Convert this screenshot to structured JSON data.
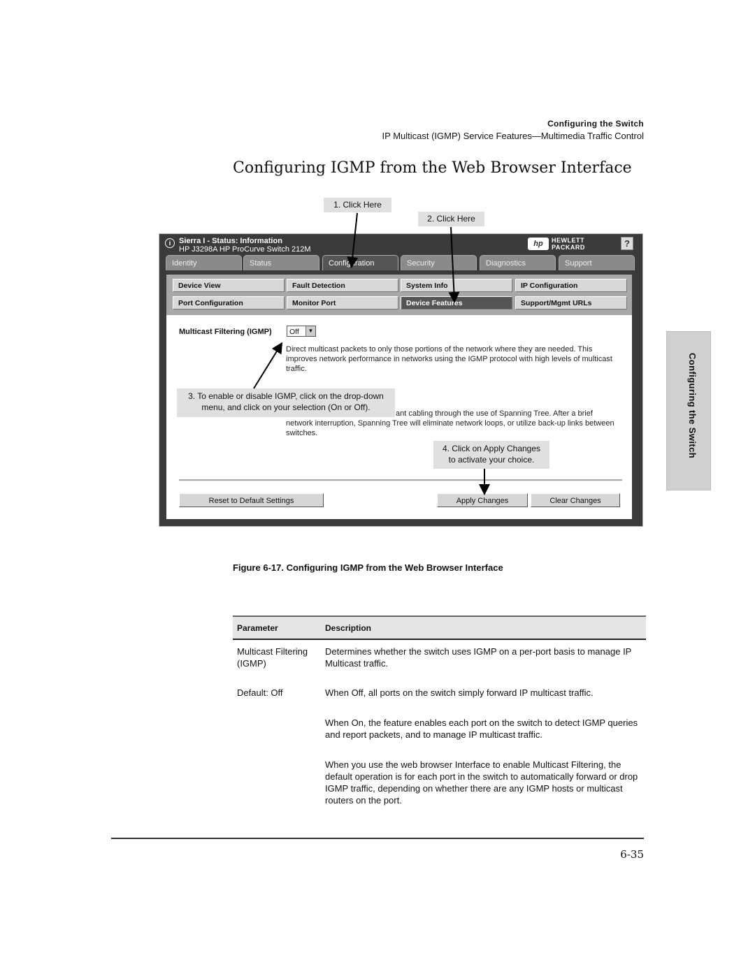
{
  "page_header": {
    "section": "Configuring the Switch",
    "subsection": "IP Multicast (IGMP) Service Features—Multimedia Traffic Control"
  },
  "title": "Configuring IGMP from the Web Browser Interface",
  "callouts": {
    "step1": "1. Click Here",
    "step2": "2. Click Here",
    "step3_line1": "3. To enable or disable IGMP, click on the drop-down",
    "step3_line2": "menu, and click on your selection (On or Off).",
    "step4_line1": "4. Click on Apply Changes",
    "step4_line2": "to activate your choice."
  },
  "window": {
    "title": "Sierra I - Status:  Information",
    "subtitle": "HP J3298A HP ProCurve Switch 212M",
    "brand_line1": "HEWLETT",
    "brand_line2": "PACKARD",
    "brand_logo": "hp",
    "help_label": "?",
    "tabs": [
      {
        "label": "Identity",
        "active": false
      },
      {
        "label": "Status",
        "active": false
      },
      {
        "label": "Configuration",
        "active": true
      },
      {
        "label": "Security",
        "active": false
      },
      {
        "label": "Diagnostics",
        "active": false
      },
      {
        "label": "Support",
        "active": false
      }
    ],
    "subnav": [
      {
        "label": "Device View"
      },
      {
        "label": "Fault Detection"
      },
      {
        "label": "System Info"
      },
      {
        "label": "IP Configuration"
      },
      {
        "label": "Port Configuration"
      },
      {
        "label": "Monitor Port"
      },
      {
        "label": "Device Features",
        "active": true
      },
      {
        "label": "Support/Mgmt URLs"
      }
    ],
    "multicast_label": "Multicast Filtering (IGMP)",
    "multicast_value": "Off",
    "desc1": "Direct multicast packets to only those portions of the network where they are needed. This improves network performance in networks using the IGMP protocol with high levels of multicast traffic.",
    "desc2": "ant cabling through the use of Spanning Tree. After a brief network interruption, Spanning Tree will eliminate network loops, or utilize back-up links between switches.",
    "buttons": {
      "reset": "Reset to Default Settings",
      "apply": "Apply Changes",
      "clear": "Clear Changes"
    }
  },
  "side_tab": "Configuring the Switch",
  "figure_caption": "Figure 6-17.  Configuring IGMP from the Web Browser Interface",
  "table": {
    "headers": [
      "Parameter",
      "Description"
    ],
    "rows": [
      {
        "param": "Multicast Filtering (IGMP)",
        "desc": "Determines whether the switch uses IGMP on a per-port basis to manage IP Multicast traffic."
      },
      {
        "param": "Default: Off",
        "desc": "When Off, all ports on the switch simply forward IP multicast traffic."
      },
      {
        "param": "",
        "desc": "When On, the feature enables each port on the switch to detect IGMP queries and report packets, and to manage IP multicast traffic."
      },
      {
        "param": "",
        "desc": "When you use the web browser Interface to enable Multicast Filtering, the default operation is for each port in the switch to automatically forward or drop IGMP traffic, depending on whether there are any IGMP hosts or multicast routers on the port."
      }
    ]
  },
  "page_number": "6-35"
}
